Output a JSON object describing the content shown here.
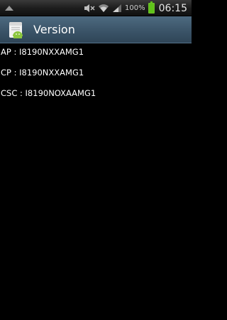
{
  "status_bar": {
    "battery_percent": "100%",
    "time": "06:15",
    "icons": [
      "notification-up-icon",
      "mute-icon",
      "wifi-icon",
      "signal-icon",
      "battery-icon"
    ]
  },
  "action_bar": {
    "title": "Version",
    "icon": "android-app-icon"
  },
  "versions": {
    "ap": "AP : I8190NXXAMG1",
    "cp": "CP : I8190NXXAMG1",
    "csc": "CSC : I8190NOXAAMG1"
  },
  "colors": {
    "background": "#000000",
    "action_bar": "#3b5468",
    "battery": "#5fc31a"
  }
}
